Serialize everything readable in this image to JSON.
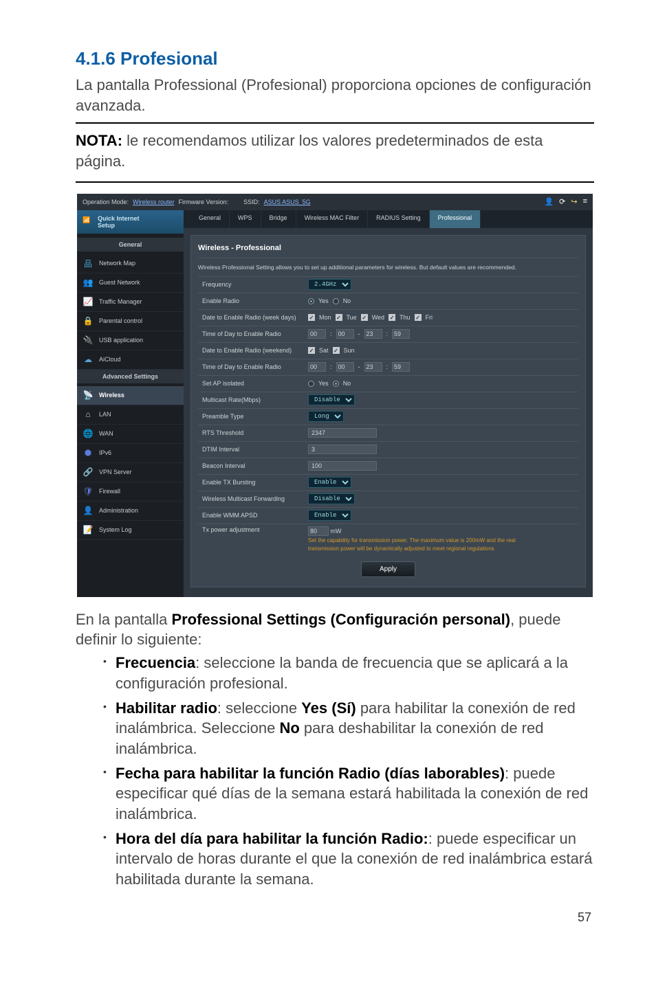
{
  "heading": "4.1.6 Profesional",
  "intro": "La pantalla Professional (Profesional) proporciona opciones de configuración avanzada.",
  "note_label": "NOTA:",
  "note_text": " le recomendamos utilizar los valores predeterminados de esta página.",
  "pagenum": "57",
  "topbar": {
    "op_mode_label": "Operation Mode:",
    "op_mode_value": "Wireless router",
    "fw_label": "Firmware Version:",
    "ssid_label": "SSID:",
    "ssid_value": "ASUS ASUS_5G"
  },
  "sidebar": {
    "qis_line1": "Quick Internet",
    "qis_line2": "Setup",
    "general_label": "General",
    "advanced_label": "Advanced Settings",
    "general": [
      "Network Map",
      "Guest Network",
      "Traffic Manager",
      "Parental control",
      "USB application",
      "AiCloud"
    ],
    "advanced": [
      "Wireless",
      "LAN",
      "WAN",
      "IPv6",
      "VPN Server",
      "Firewall",
      "Administration",
      "System Log"
    ]
  },
  "tabs": [
    "General",
    "WPS",
    "Bridge",
    "Wireless MAC Filter",
    "RADIUS Setting",
    "Professional"
  ],
  "panel": {
    "title": "Wireless - Professional",
    "desc": "Wireless Professional Setting allows you to set up additional parameters for wireless. But default values are recommended.",
    "freq_label": "Frequency",
    "freq_value": "2.4GHz",
    "enable_radio_label": "Enable Radio",
    "yes": "Yes",
    "no": "No",
    "date_week_label": "Date to Enable Radio (week days)",
    "days_week": [
      "Mon",
      "Tue",
      "Wed",
      "Thu",
      "Fri"
    ],
    "time_week_label": "Time of Day to Enable Radio",
    "t1": [
      "00",
      "00",
      "23",
      "59"
    ],
    "date_weekend_label": "Date to Enable Radio (weekend)",
    "days_weekend": [
      "Sat",
      "Sun"
    ],
    "time_weekend_label": "Time of Day to Enable Radio",
    "t2": [
      "00",
      "00",
      "23",
      "59"
    ],
    "set_ap_label": "Set AP isolated",
    "multicast_label": "Multicast Rate(Mbps)",
    "multicast_value": "Disable",
    "preamble_label": "Preamble Type",
    "preamble_value": "Long",
    "rts_label": "RTS Threshold",
    "rts_value": "2347",
    "dtim_label": "DTIM Interval",
    "dtim_value": "3",
    "beacon_label": "Beacon Interval",
    "beacon_value": "100",
    "txburst_label": "Enable TX Bursting",
    "txburst_value": "Enable",
    "wmf_label": "Wireless Multicast Forwarding",
    "wmf_value": "Disable",
    "wmm_label": "Enable WMM APSD",
    "wmm_value": "Enable",
    "txpow_label": "Tx power adjustment",
    "txpow_value": "80",
    "txpow_unit": "mW",
    "txpow_note1": "Set the capability for transmission power. The maximum value is 200mW and the real",
    "txpow_note2": "transmission power will be dynamically adjusted to meet regional regulations",
    "apply": "Apply"
  },
  "body_text": {
    "intro1": "En la pantalla ",
    "intro_strong": "Professional Settings (Configuración personal)",
    "intro2": ", puede definir lo siguiente:",
    "b1_strong": "Frecuencia",
    "b1_text": ":  seleccione la banda de frecuencia que se aplicará a la configuración profesional.",
    "b2_strong": "Habilitar radio",
    "b2_text_a": ":  seleccione ",
    "b2_yes": "Yes (Sí)",
    "b2_text_b": " para habilitar la conexión de red inalámbrica. Seleccione ",
    "b2_no": "No",
    "b2_text_c": " para deshabilitar la conexión de red inalámbrica.",
    "b3_strong": "Fecha para habilitar la función Radio (días laborables)",
    "b3_text": ":  puede especificar qué días de la semana estará habilitada la conexión de red inalámbrica.",
    "b4_strong": "Hora del día para habilitar la función Radio:",
    "b4_text": ":  puede especificar un intervalo de horas durante el que la conexión de red inalámbrica estará habilitada durante la semana."
  }
}
